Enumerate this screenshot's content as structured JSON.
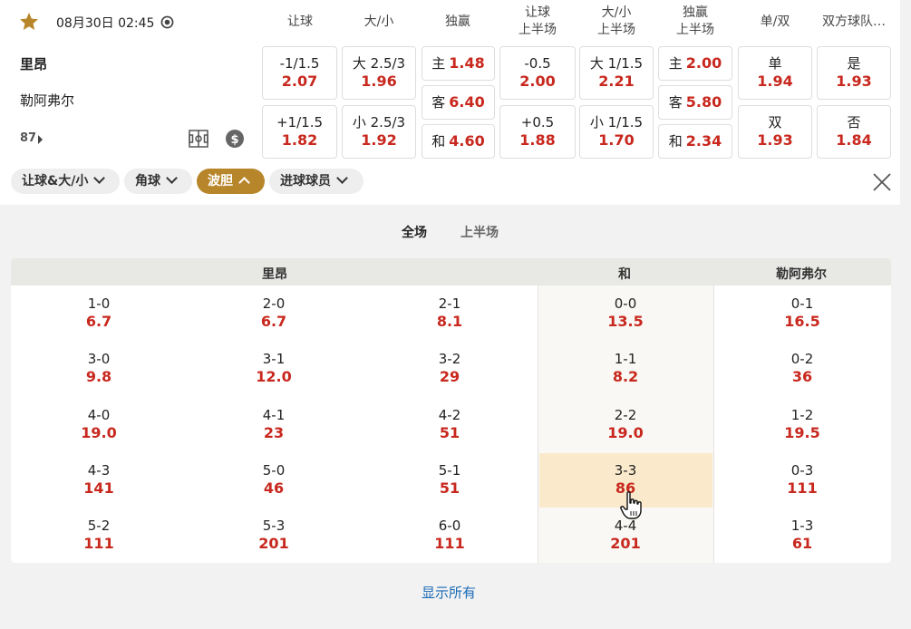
{
  "match": {
    "datetime": "08月30日 02:45",
    "home": "里昂",
    "away": "勒阿弗尔",
    "markets_count": "87"
  },
  "headers": [
    "让球",
    "大/小",
    "独赢",
    "让球\n上半场",
    "大/小\n上半场",
    "独赢\n上半场",
    "单/双",
    "双方球队…"
  ],
  "odds": {
    "handicap": [
      {
        "label": "-1/1.5",
        "odd": "2.07"
      },
      {
        "label": "+1/1.5",
        "odd": "1.82"
      }
    ],
    "overunder": [
      {
        "label": "大 2.5/3",
        "odd": "1.96"
      },
      {
        "label": "小 2.5/3",
        "odd": "1.92"
      }
    ],
    "moneyline": [
      {
        "label": "主",
        "odd": "1.48"
      },
      {
        "label": "客",
        "odd": "6.40"
      },
      {
        "label": "和",
        "odd": "4.60"
      }
    ],
    "handicap_1h": [
      {
        "label": "-0.5",
        "odd": "2.00"
      },
      {
        "label": "+0.5",
        "odd": "1.88"
      }
    ],
    "overunder_1h": [
      {
        "label": "大 1/1.5",
        "odd": "2.21"
      },
      {
        "label": "小 1/1.5",
        "odd": "1.70"
      }
    ],
    "moneyline_1h": [
      {
        "label": "主",
        "odd": "2.00"
      },
      {
        "label": "客",
        "odd": "5.80"
      },
      {
        "label": "和",
        "odd": "2.34"
      }
    ],
    "oddeven": [
      {
        "label": "单",
        "odd": "1.94"
      },
      {
        "label": "双",
        "odd": "1.93"
      }
    ],
    "btts": [
      {
        "label": "是",
        "odd": "1.93"
      },
      {
        "label": "否",
        "odd": "1.84"
      }
    ]
  },
  "tags": [
    "让球&大/小",
    "角球",
    "波胆",
    "进球球员"
  ],
  "subtabs": [
    "全场",
    "上半场"
  ],
  "grid": {
    "headers": [
      "里昂",
      "和",
      "勒阿弗尔"
    ],
    "rows": [
      [
        {
          "s": "1-0",
          "o": "6.7"
        },
        {
          "s": "2-0",
          "o": "6.7"
        },
        {
          "s": "2-1",
          "o": "8.1"
        },
        {
          "s": "0-0",
          "o": "13.5"
        },
        {
          "s": "0-1",
          "o": "16.5"
        }
      ],
      [
        {
          "s": "3-0",
          "o": "9.8"
        },
        {
          "s": "3-1",
          "o": "12.0"
        },
        {
          "s": "3-2",
          "o": "29"
        },
        {
          "s": "1-1",
          "o": "8.2"
        },
        {
          "s": "0-2",
          "o": "36"
        }
      ],
      [
        {
          "s": "4-0",
          "o": "19.0"
        },
        {
          "s": "4-1",
          "o": "23"
        },
        {
          "s": "4-2",
          "o": "51"
        },
        {
          "s": "2-2",
          "o": "19.0"
        },
        {
          "s": "1-2",
          "o": "19.5"
        }
      ],
      [
        {
          "s": "4-3",
          "o": "141"
        },
        {
          "s": "5-0",
          "o": "46"
        },
        {
          "s": "5-1",
          "o": "51"
        },
        {
          "s": "3-3",
          "o": "86"
        },
        {
          "s": "0-3",
          "o": "111"
        }
      ],
      [
        {
          "s": "5-2",
          "o": "111"
        },
        {
          "s": "5-3",
          "o": "201"
        },
        {
          "s": "6-0",
          "o": "111"
        },
        {
          "s": "4-4",
          "o": "201"
        },
        {
          "s": "1-3",
          "o": "61"
        }
      ]
    ]
  },
  "show_all": "显示所有",
  "colors": {
    "accent": "#b8862a",
    "odd": "#c8281e",
    "link": "#1b6bb5",
    "highlight": "#faeacb"
  }
}
